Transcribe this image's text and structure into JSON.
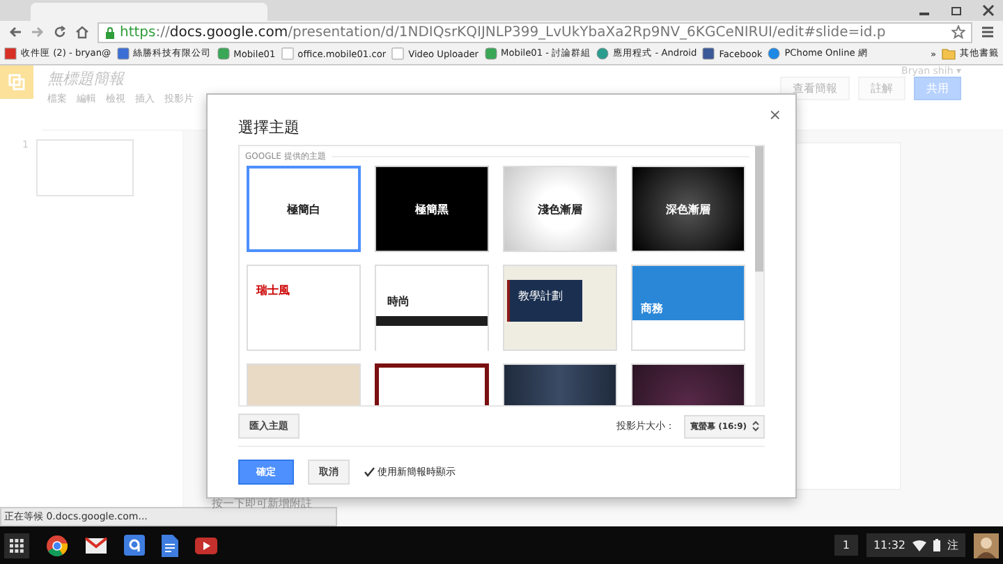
{
  "browser": {
    "url": {
      "scheme": "https",
      "separator": "://",
      "host": "docs.google.com",
      "path": "/presentation/d/1NDIQsrKQIJNLP399_LvUkYbaXa2Rp9NV_6KGCeNIRUI/edit#slide=id.p"
    },
    "bookmarks": [
      {
        "kind": "mail",
        "label": "收件匣 (2) - bryan@"
      },
      {
        "kind": "calendar",
        "label": "絲勝科技有限公司"
      },
      {
        "kind": "forum",
        "label": "Mobile01"
      },
      {
        "kind": "page",
        "label": "office.mobile01.cor"
      },
      {
        "kind": "page",
        "label": "Video Uploader"
      },
      {
        "kind": "forum",
        "label": "Mobile01 - 討論群組"
      },
      {
        "kind": "store",
        "label": "應用程式 - Android"
      },
      {
        "kind": "social",
        "label": "Facebook"
      },
      {
        "kind": "portal",
        "label": "PChome Online 網"
      }
    ],
    "overflow": "»",
    "other_bookmarks": "其他書籤"
  },
  "docs": {
    "title": "無標題簡報",
    "menu": [
      "檔案",
      "編輯",
      "檢視",
      "插入",
      "投影片"
    ],
    "user": "Bryan shih ▾",
    "present": "查看簡報",
    "comments": "註解",
    "share": "共用",
    "slide_number": "1",
    "notes_placeholder": "按一下即可新增附註"
  },
  "dialog": {
    "title": "選擇主題",
    "close": "×",
    "section": "GOOGLE 提供的主題",
    "themes": [
      {
        "kind": "simple-light",
        "label": "極簡白",
        "selected": true
      },
      {
        "kind": "simple-dark",
        "label": "極簡黑",
        "selected": false
      },
      {
        "kind": "light-gradient",
        "label": "淺色漸層",
        "selected": false
      },
      {
        "kind": "dark-gradient",
        "label": "深色漸層",
        "selected": false
      },
      {
        "kind": "swiss",
        "label": "瑞士風",
        "selected": false
      },
      {
        "kind": "fashion",
        "label": "時尚",
        "selected": false
      },
      {
        "kind": "classroom",
        "label": "教學計劃",
        "selected": false
      },
      {
        "kind": "business",
        "label": "商務",
        "selected": false
      },
      {
        "kind": "beige",
        "selected": false
      },
      {
        "kind": "frame",
        "selected": false
      },
      {
        "kind": "navy",
        "selected": false
      },
      {
        "kind": "plum",
        "selected": false
      }
    ],
    "import": "匯入主題",
    "size_label": "投影片大小：",
    "size_value": "寬螢幕 (16:9)",
    "ok": "確定",
    "cancel": "取消",
    "show_on_new": {
      "label": "使用新簡報時顯示",
      "checked": true
    }
  },
  "status": "正在等候 0.docs.google.com...",
  "taskbar": {
    "apps": [
      {
        "kind": "launcher"
      },
      {
        "kind": "chrome"
      },
      {
        "kind": "gmail"
      },
      {
        "kind": "search"
      },
      {
        "kind": "docs"
      },
      {
        "kind": "youtube"
      }
    ],
    "notifications": "1",
    "time": "11:32",
    "ime": "注"
  }
}
